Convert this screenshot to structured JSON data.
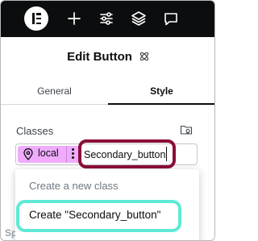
{
  "topbar": {
    "logo_icon": "elementor-logo-icon",
    "icons": [
      "plus-icon",
      "sliders-icon",
      "layers-icon",
      "comment-icon"
    ]
  },
  "panel": {
    "title": "Edit Button",
    "title_icon": "atom-icon"
  },
  "tabs": [
    {
      "label": "General",
      "active": false
    },
    {
      "label": "Style",
      "active": true
    }
  ],
  "classes": {
    "label": "Classes",
    "chip": {
      "label": "local",
      "color": "#f0abfc"
    },
    "input_value": "Secondary_button"
  },
  "dropdown": {
    "hint": "Create a new class",
    "create_item": "Create \"Secondary_button\""
  },
  "underlying": {
    "section_label": "Spacing"
  },
  "colors": {
    "topbar": "#0c0d0e",
    "input_highlight": "#8b0d3a",
    "create_highlight": "#5eead4"
  }
}
